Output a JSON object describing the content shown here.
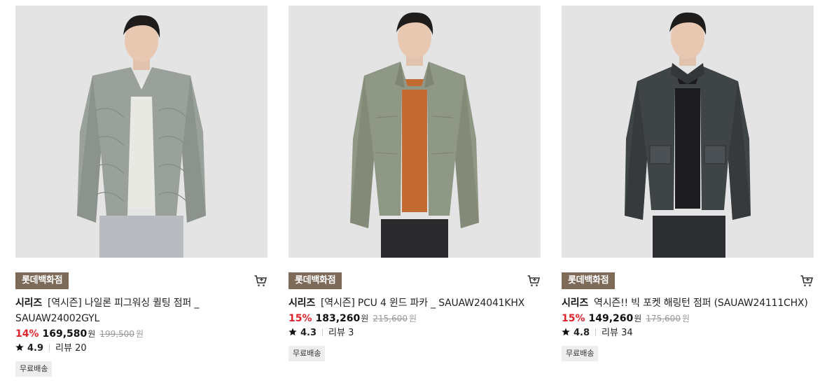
{
  "products": [
    {
      "store_badge": "롯데백화점",
      "brand": "시리즈",
      "name": "[역시즌] 나일론 피그워싱 퀼팅 점퍼 _ SAUAW24002GYL",
      "discount": "14%",
      "sale_price": "169,580",
      "currency": "원",
      "original_price": "199,500",
      "rating": "4.9",
      "review_label": "리뷰 20",
      "shipping": "무료배송",
      "jacket_color": "#9aa19b"
    },
    {
      "store_badge": "롯데백화점",
      "brand": "시리즈",
      "name": "[역시즌] PCU 4 윈드 파카 _ SAUAW24041KHX",
      "discount": "15%",
      "sale_price": "183,260",
      "currency": "원",
      "original_price": "215,600",
      "rating": "4.3",
      "review_label": "리뷰 3",
      "shipping": "무료배송",
      "jacket_color": "#8f9884"
    },
    {
      "store_badge": "롯데백화점",
      "brand": "시리즈",
      "name": "역시즌!! 빅 포켓 해링턴 점퍼 (SAUAW24111CHX)",
      "discount": "15%",
      "sale_price": "149,260",
      "currency": "원",
      "original_price": "175,600",
      "rating": "4.8",
      "review_label": "리뷰 34",
      "shipping": "무료배송",
      "jacket_color": "#3f4446"
    }
  ],
  "icons": {
    "cart": "cart-icon",
    "star": "star-icon"
  },
  "colors": {
    "badge_bg": "#7d6a58",
    "discount": "#e0242b"
  }
}
